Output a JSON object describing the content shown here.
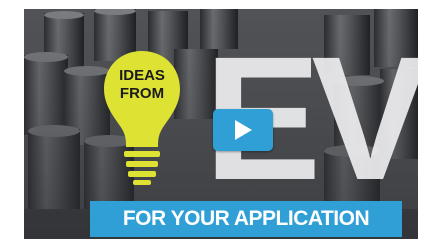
{
  "bulb": {
    "line1": "IDEAS",
    "line2": "FROM"
  },
  "headline": "EV",
  "banner": {
    "text": "FOR YOUR APPLICATION"
  },
  "play_button": {
    "icon": "play-icon"
  },
  "colors": {
    "bulb": "#dde233",
    "accent_blue": "#2f9fd6",
    "headline": "#eeeef0"
  }
}
